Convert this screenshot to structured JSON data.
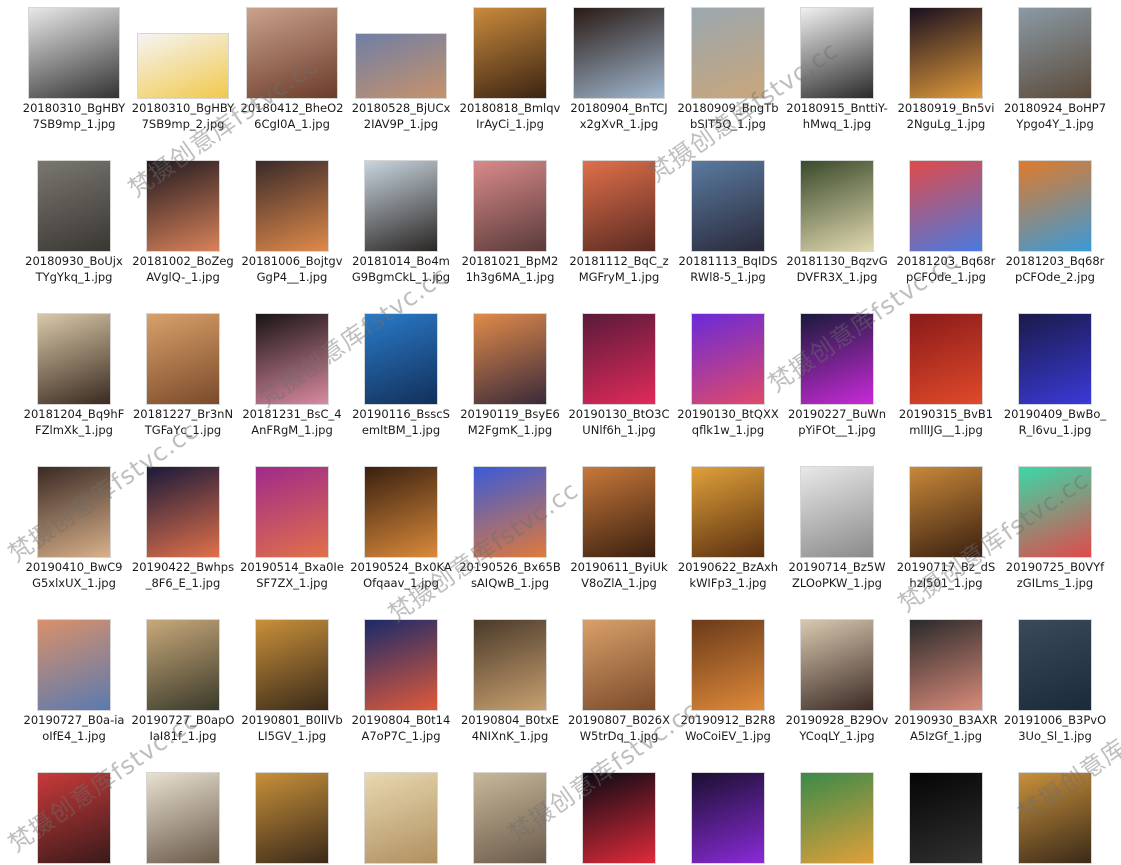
{
  "watermark_text": "梵摄创意库fstvc.cc",
  "files": [
    {
      "name": "20180310_BgHBY7SB9mp_1.jpg",
      "colors": [
        "#e8e8e8",
        "#333333"
      ],
      "ar": "square"
    },
    {
      "name": "20180310_BgHBY7SB9mp_2.jpg",
      "colors": [
        "#f4f4f4",
        "#f2c94c"
      ],
      "ar": "land"
    },
    {
      "name": "20180412_BheO26CgI0A_1.jpg",
      "colors": [
        "#c9a28c",
        "#6b3b2a"
      ],
      "ar": "square"
    },
    {
      "name": "20180528_BjUCx2IAV9P_1.jpg",
      "colors": [
        "#6f7fa6",
        "#c7926a"
      ],
      "ar": "land"
    },
    {
      "name": "20180818_BmlqvIrAyCi_1.jpg",
      "colors": [
        "#c98a3c",
        "#3b2413"
      ],
      "ar": "portrait"
    },
    {
      "name": "20180904_BnTCJx2gXvR_1.jpg",
      "colors": [
        "#2a1b15",
        "#a0b7cf"
      ],
      "ar": "square"
    },
    {
      "name": "20180909_BngTbbSIT5Q_1.jpg",
      "colors": [
        "#9aa7b0",
        "#c9a67a"
      ],
      "ar": "portrait"
    },
    {
      "name": "20180915_BnttiY-hMwq_1.jpg",
      "colors": [
        "#f0f0f0",
        "#2a2a2a"
      ],
      "ar": "portrait"
    },
    {
      "name": "20180919_Bn5vi2NguLg_1.jpg",
      "colors": [
        "#1a1020",
        "#e09a3a"
      ],
      "ar": "portrait"
    },
    {
      "name": "20180924_BoHP7Ypgo4Y_1.jpg",
      "colors": [
        "#8a9aa5",
        "#5b4a3a"
      ],
      "ar": "portrait"
    },
    {
      "name": "20180930_BoUjxTYgYkq_1.jpg",
      "colors": [
        "#7a7670",
        "#3a3632"
      ],
      "ar": "portrait"
    },
    {
      "name": "20181002_BoZegAVglQ-_1.jpg",
      "colors": [
        "#201a20",
        "#d9825a"
      ],
      "ar": "portrait"
    },
    {
      "name": "20181006_BojtgvGgP4__1.jpg",
      "colors": [
        "#3a2a2a",
        "#e08a4a"
      ],
      "ar": "portrait"
    },
    {
      "name": "20181014_Bo4mG9BgmCkL_1.jpg",
      "colors": [
        "#c8d4de",
        "#2a2624"
      ],
      "ar": "portrait"
    },
    {
      "name": "20181021_BpM21h3g6MA_1.jpg",
      "colors": [
        "#d98a8a",
        "#5a3a3a"
      ],
      "ar": "portrait"
    },
    {
      "name": "20181112_BqC_zMGFryM_1.jpg",
      "colors": [
        "#e0704a",
        "#5a2a22"
      ],
      "ar": "portrait"
    },
    {
      "name": "20181113_BqIDSRWl8-5_1.jpg",
      "colors": [
        "#5a7aa0",
        "#2a2a3a"
      ],
      "ar": "portrait"
    },
    {
      "name": "20181130_BqzvGDVFR3X_1.jpg",
      "colors": [
        "#3a4a2a",
        "#e0d8b0"
      ],
      "ar": "portrait"
    },
    {
      "name": "20181203_Bq68rpCFOde_1.jpg",
      "colors": [
        "#e04a4a",
        "#4a7ae0"
      ],
      "ar": "portrait"
    },
    {
      "name": "20181203_Bq68rpCFOde_2.jpg",
      "colors": [
        "#e07a2a",
        "#3a9ad8"
      ],
      "ar": "portrait"
    },
    {
      "name": "20181204_Bq9hFFZlmXk_1.jpg",
      "colors": [
        "#d9c8a8",
        "#3a2a20"
      ],
      "ar": "portrait"
    },
    {
      "name": "20181227_Br3nNTGFaYc_1.jpg",
      "colors": [
        "#d9a06a",
        "#7a4a2a"
      ],
      "ar": "portrait"
    },
    {
      "name": "20181231_BsC_4AnFRgM_1.jpg",
      "colors": [
        "#1a1414",
        "#d98aa0"
      ],
      "ar": "portrait"
    },
    {
      "name": "20190116_BsscSemltBM_1.jpg",
      "colors": [
        "#2a7ac8",
        "#12305a"
      ],
      "ar": "portrait"
    },
    {
      "name": "20190119_BsyE6M2FgmK_1.jpg",
      "colors": [
        "#e08a4a",
        "#3a2a3a"
      ],
      "ar": "portrait"
    },
    {
      "name": "20190130_BtO3CUNlf6h_1.jpg",
      "colors": [
        "#5a1a3a",
        "#e02a5a"
      ],
      "ar": "portrait"
    },
    {
      "name": "20190130_BtQXXqflk1w_1.jpg",
      "colors": [
        "#6a2ad8",
        "#e04a6a"
      ],
      "ar": "portrait"
    },
    {
      "name": "20190227_BuWnpYiFOt__1.jpg",
      "colors": [
        "#1a1a3a",
        "#c82ad8"
      ],
      "ar": "portrait"
    },
    {
      "name": "20190315_BvB1mllIJG__1.jpg",
      "colors": [
        "#8a1a1a",
        "#e04a2a"
      ],
      "ar": "portrait"
    },
    {
      "name": "20190409_BwBo_R_l6vu_1.jpg",
      "colors": [
        "#1a1a4a",
        "#3a3ad8"
      ],
      "ar": "portrait"
    },
    {
      "name": "20190410_BwC9G5xlxUX_1.jpg",
      "colors": [
        "#3a2a24",
        "#d9b08a"
      ],
      "ar": "portrait"
    },
    {
      "name": "20190422_Bwhps_8F6_E_1.jpg",
      "colors": [
        "#1a1a3a",
        "#e0704a"
      ],
      "ar": "portrait"
    },
    {
      "name": "20190514_Bxa0IeSF7ZX_1.jpg",
      "colors": [
        "#a02a8a",
        "#e0704a"
      ],
      "ar": "portrait"
    },
    {
      "name": "20190524_Bx0KAOfqaav_1.jpg",
      "colors": [
        "#3a2010",
        "#d98a3a"
      ],
      "ar": "portrait"
    },
    {
      "name": "20190526_Bx65BsAIQwB_1.jpg",
      "colors": [
        "#3a5ad8",
        "#e07a3a"
      ],
      "ar": "portrait"
    },
    {
      "name": "20190611_ByiUkV8oZlA_1.jpg",
      "colors": [
        "#c8783a",
        "#3a2010"
      ],
      "ar": "portrait"
    },
    {
      "name": "20190622_BzAxhkWIFp3_1.jpg",
      "colors": [
        "#e0a03a",
        "#5a3010"
      ],
      "ar": "portrait"
    },
    {
      "name": "20190714_Bz5WZLOoPKW_1.jpg",
      "colors": [
        "#e8e8e8",
        "#8a8a8a"
      ],
      "ar": "portrait"
    },
    {
      "name": "20190717_Bz_dShzI501_1.jpg",
      "colors": [
        "#c8883a",
        "#3a2010"
      ],
      "ar": "portrait"
    },
    {
      "name": "20190725_B0VYfzGILms_1.jpg",
      "colors": [
        "#3ad8a8",
        "#e04a4a"
      ],
      "ar": "portrait"
    },
    {
      "name": "20190727_B0a-iaoIfE4_1.jpg",
      "colors": [
        "#d9906a",
        "#5a7ab0"
      ],
      "ar": "portrait"
    },
    {
      "name": "20190727_B0apOIaI81f_1.jpg",
      "colors": [
        "#c8a87a",
        "#3a3a2a"
      ],
      "ar": "portrait"
    },
    {
      "name": "20190801_B0lIVbLI5GV_1.jpg",
      "colors": [
        "#c8903a",
        "#3a2a1a"
      ],
      "ar": "portrait"
    },
    {
      "name": "20190804_B0t14A7oP7C_1.jpg",
      "colors": [
        "#1a2a6a",
        "#e05a3a"
      ],
      "ar": "portrait"
    },
    {
      "name": "20190804_B0txE4NIXnK_1.jpg",
      "colors": [
        "#4a3a2a",
        "#c8a070"
      ],
      "ar": "portrait"
    },
    {
      "name": "20190807_B026XW5trDq_1.jpg",
      "colors": [
        "#d9a06a",
        "#7a4a2a"
      ],
      "ar": "portrait"
    },
    {
      "name": "20190912_B2R8WoCoiEV_1.jpg",
      "colors": [
        "#6a3a1a",
        "#e08a3a"
      ],
      "ar": "portrait"
    },
    {
      "name": "20190928_B29OvYCoqLY_1.jpg",
      "colors": [
        "#d9c8b0",
        "#3a2a24"
      ],
      "ar": "portrait"
    },
    {
      "name": "20190930_B3AXRA5IzGf_1.jpg",
      "colors": [
        "#2a2a2a",
        "#d98a7a"
      ],
      "ar": "portrait"
    },
    {
      "name": "20191006_B3PvO3Uo_Sl_1.jpg",
      "colors": [
        "#3a4a5a",
        "#1a2a3a"
      ],
      "ar": "portrait"
    },
    {
      "name": "",
      "colors": [
        "#c83a3a",
        "#3a1a1a"
      ],
      "ar": "portrait"
    },
    {
      "name": "",
      "colors": [
        "#e8e0d0",
        "#6a5a4a"
      ],
      "ar": "portrait"
    },
    {
      "name": "",
      "colors": [
        "#c8903a",
        "#3a2a1a"
      ],
      "ar": "portrait"
    },
    {
      "name": "",
      "colors": [
        "#e8d8b0",
        "#b09060"
      ],
      "ar": "portrait"
    },
    {
      "name": "",
      "colors": [
        "#c8b89a",
        "#6a5a4a"
      ],
      "ar": "portrait"
    },
    {
      "name": "",
      "colors": [
        "#0a0a14",
        "#e02a3a"
      ],
      "ar": "portrait"
    },
    {
      "name": "",
      "colors": [
        "#1a1030",
        "#8a2ad8"
      ],
      "ar": "portrait"
    },
    {
      "name": "",
      "colors": [
        "#3a8a4a",
        "#e0a03a"
      ],
      "ar": "portrait"
    },
    {
      "name": "",
      "colors": [
        "#050505",
        "#303030"
      ],
      "ar": "portrait"
    },
    {
      "name": "",
      "colors": [
        "#c8903a",
        "#3a2a1a"
      ],
      "ar": "portrait"
    }
  ]
}
